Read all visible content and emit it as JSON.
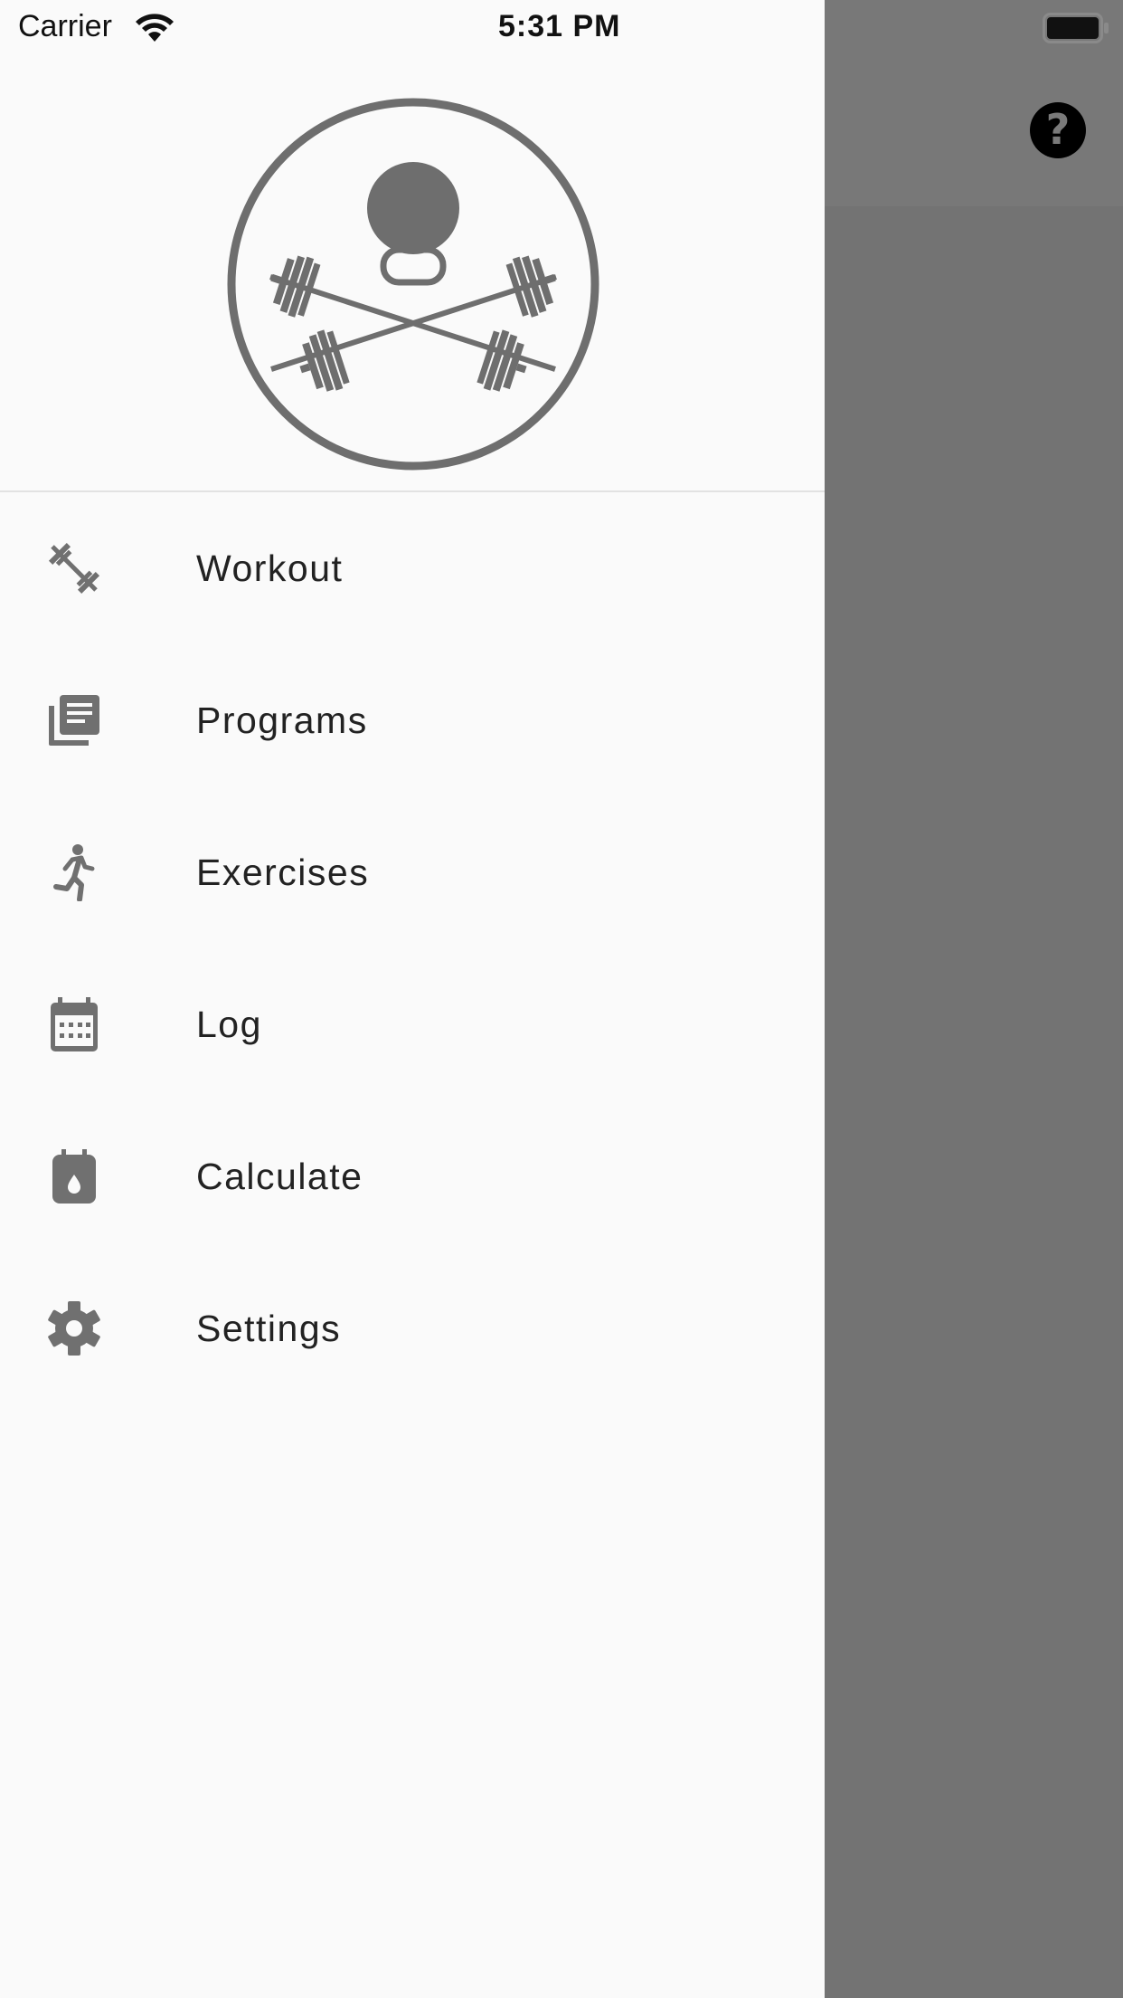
{
  "status_bar": {
    "carrier": "Carrier",
    "time": "5:31 PM"
  },
  "drawer": {
    "logo": "barbell-kettlebell-logo",
    "items": [
      {
        "label": "Workout",
        "icon": "barbell-icon"
      },
      {
        "label": "Programs",
        "icon": "library-books-icon"
      },
      {
        "label": "Exercises",
        "icon": "running-figure-icon"
      },
      {
        "label": "Log",
        "icon": "calendar-icon"
      },
      {
        "label": "Calculate",
        "icon": "clipboard-drop-icon"
      },
      {
        "label": "Settings",
        "icon": "gear-icon"
      }
    ]
  },
  "background": {
    "help_icon": "question-mark-icon"
  },
  "colors": {
    "drawer_bg": "#fafafa",
    "scrim": "#737373",
    "icon_gray": "#707070",
    "text": "#222222"
  }
}
